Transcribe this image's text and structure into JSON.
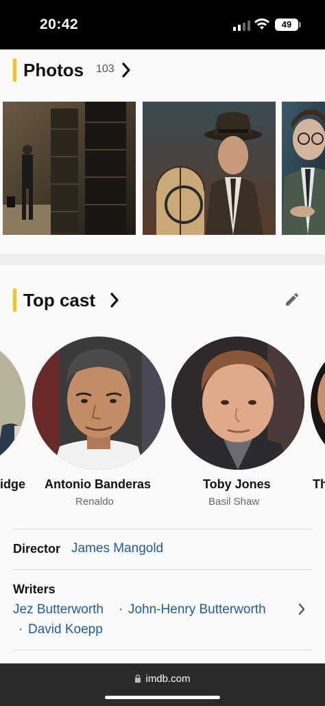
{
  "status_bar": {
    "time": "20:42",
    "battery": "49"
  },
  "photos": {
    "title": "Photos",
    "count": "103",
    "items": [
      "photo-archive",
      "photo-hat-man",
      "photo-glasses-man"
    ]
  },
  "top_cast": {
    "title": "Top cast",
    "partial_left_name": "idge",
    "partial_right_name": "Th",
    "members": [
      {
        "name": "Antonio Banderas",
        "role": "Renaldo"
      },
      {
        "name": "Toby Jones",
        "role": "Basil Shaw"
      }
    ]
  },
  "credits": {
    "director_label": "Director",
    "director": "James Mangold",
    "writers_label": "Writers",
    "writers": [
      "Jez Butterworth",
      "John-Henry Butterworth",
      "David Koepp"
    ],
    "separator": "·"
  },
  "browser": {
    "url": "imdb.com"
  },
  "colors": {
    "accent": "#f5c518",
    "link": "#1f5c99"
  }
}
